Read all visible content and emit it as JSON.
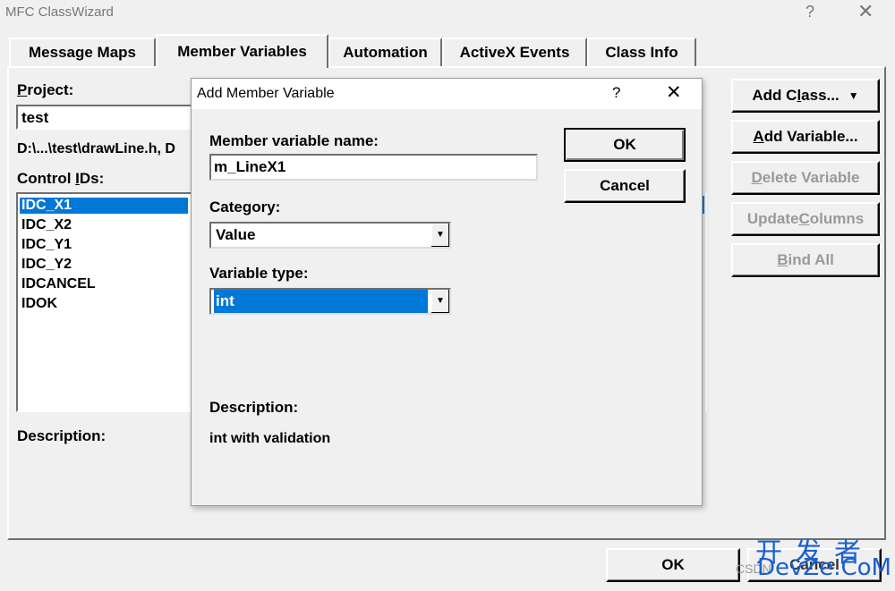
{
  "window": {
    "title": "MFC ClassWizard",
    "help_glyph": "?",
    "close_glyph": "✕"
  },
  "tabs": [
    {
      "label": "Message Maps"
    },
    {
      "label": "Member Variables"
    },
    {
      "label": "Automation"
    },
    {
      "label": "ActiveX Events"
    },
    {
      "label": "Class Info"
    }
  ],
  "left": {
    "project_label_u": "P",
    "project_label_rest": "roject:",
    "project_value": "test",
    "file_path": "D:\\...\\test\\drawLine.h, D",
    "control_ids_label_pre": "Control ",
    "control_ids_label_u": "I",
    "control_ids_label_post": "Ds:",
    "control_ids": [
      "IDC_X1",
      "IDC_X2",
      "IDC_Y1",
      "IDC_Y2",
      "IDCANCEL",
      "IDOK"
    ],
    "description_label": "Description:"
  },
  "right_buttons": {
    "add_class_pre": "Add C",
    "add_class_u": "l",
    "add_class_post": "ass...",
    "add_class_arrow": "▼",
    "add_variable_u": "A",
    "add_variable_post": "dd Variable...",
    "delete_variable_u": "D",
    "delete_variable_post": "elete Variable",
    "update_columns_pre": "Update ",
    "update_columns_u": "C",
    "update_columns_post": "olumns",
    "bind_all_u": "B",
    "bind_all_post": "ind All"
  },
  "bottom": {
    "ok_label": "OK",
    "cancel_label": "Cancel"
  },
  "dialog": {
    "title": "Add Member Variable",
    "help_glyph": "?",
    "close_glyph": "✕",
    "name_label": "Member variable name:",
    "name_value": "m_LineX1",
    "category_label": "Category:",
    "category_value": "Value",
    "type_label": "Variable type:",
    "type_value": "int",
    "description_label": "Description:",
    "description_value": "int with validation",
    "ok_label": "OK",
    "cancel_label": "Cancel"
  },
  "watermark": {
    "cn": "开发者",
    "en": "DevZe.CoM",
    "csdn": "CSDN"
  },
  "colors": {
    "selection": "#0078d7",
    "watermark": "#1a5fd0"
  }
}
